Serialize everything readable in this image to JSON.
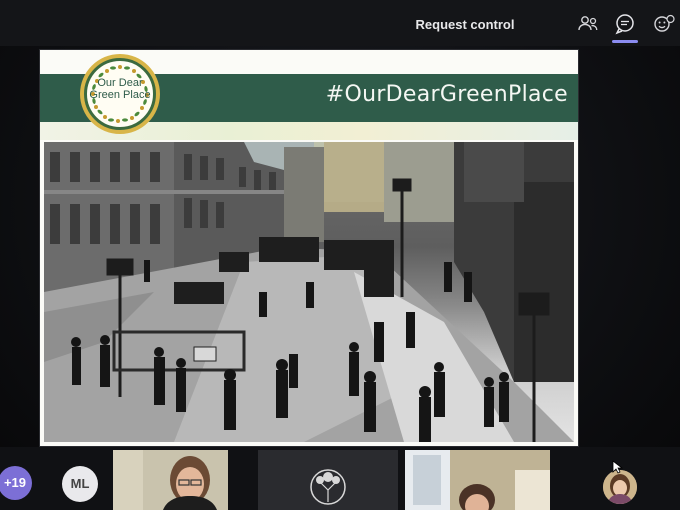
{
  "toolbar": {
    "request_control_label": "Request control",
    "icons": [
      "people-icon",
      "chat-icon",
      "reactions-icon"
    ],
    "accent": "#8b8cf0"
  },
  "slide": {
    "logo_text": "Our Dear Green Place",
    "hashtag": "#OurDearGreenPlace",
    "banner_color": "#2f5c4a"
  },
  "participants": {
    "overflow_count": "+19",
    "initials": "ML"
  }
}
